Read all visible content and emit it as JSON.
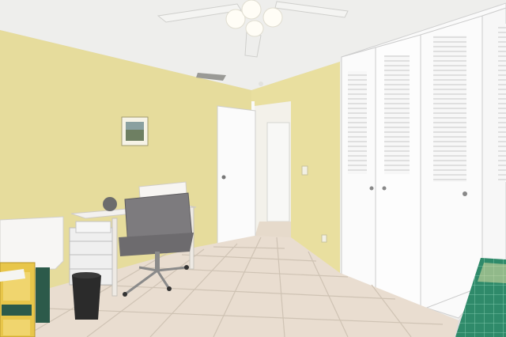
{
  "scene": {
    "description_none": "",
    "colors": {
      "ceiling": "#eeeeec",
      "wall": "#e6dc9c",
      "wall_shadow": "#d9cf8e",
      "door": "#fbfbfb",
      "floor_tile": "#e9ddd0",
      "grout": "#cfc3b4",
      "chair": "#7d7b7e",
      "mat": "#2f8a6a"
    }
  }
}
